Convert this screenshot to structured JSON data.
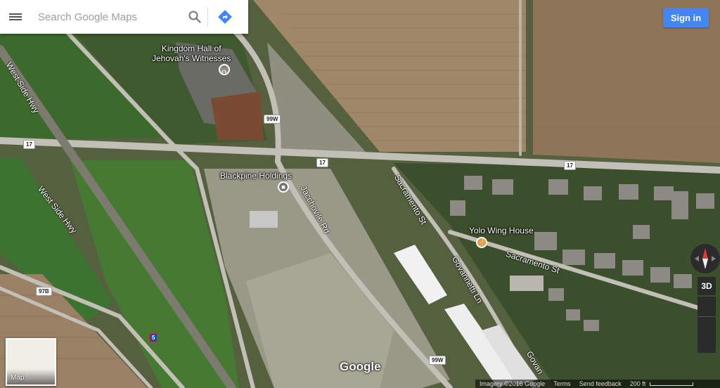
{
  "search": {
    "placeholder": "Search Google Maps"
  },
  "header": {
    "sign_in_label": "Sign in"
  },
  "places": {
    "kingdom_hall": "Kingdom Hall of\nJehovah's Witnesses",
    "blackpine": "Blackpine Holdings",
    "yolo": "Yolo Wing House"
  },
  "streets": {
    "west_side_hwy_top": "West Side Hwy",
    "west_side_hwy": "West Side Hwy",
    "sacramento_st_1": "Sacramento St",
    "sacramento_st_2": "Sacramento St",
    "gacchovile_rd": "Jacchovile Rd",
    "govannetti_ln": "Govannetti Ln",
    "govan": "Govan"
  },
  "shields": {
    "s99w_top": "99W",
    "s17_left": "17",
    "s17_mid": "17",
    "s17_right": "17",
    "s97b": "97B",
    "s5": "5",
    "s99w_bottom": "99W"
  },
  "layer_thumb": {
    "label": "Map"
  },
  "controls": {
    "three_d": "3D"
  },
  "footer": {
    "imagery": "Imagery ©2016 Google",
    "terms": "Terms",
    "feedback": "Send feedback",
    "scale": "200 ft"
  },
  "logo": "Google",
  "colors": {
    "sign_in": "#4285f4",
    "directions": "#4285f4",
    "restaurant": "#f29b2c",
    "poi_gray": "#757575",
    "church": "#8a8a8a"
  }
}
